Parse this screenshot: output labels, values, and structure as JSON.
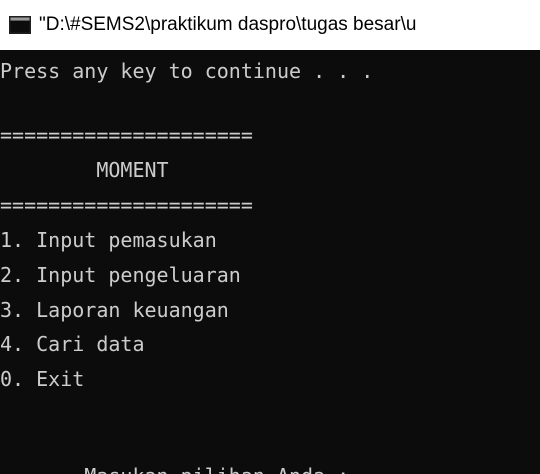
{
  "window": {
    "title": "\"D:\\#SEMS2\\praktikum daspro\\tugas besar\\u",
    "icon": "console-window-icon"
  },
  "console": {
    "line_continue": "Press any key to continue . . .",
    "separator_top": "=====================",
    "header": "        MOMENT",
    "separator_bottom": "=====================",
    "menu": [
      "1. Input pemasukan",
      "2. Input pengeluaran",
      "3. Laporan keuangan",
      "4. Cari data",
      "0. Exit"
    ],
    "prompt": " Masukan pilihan Anda : "
  },
  "colors": {
    "background": "#0c0c0c",
    "text": "#cccccc",
    "titlebar": "#ffffff",
    "cursor": "#ffffff"
  }
}
